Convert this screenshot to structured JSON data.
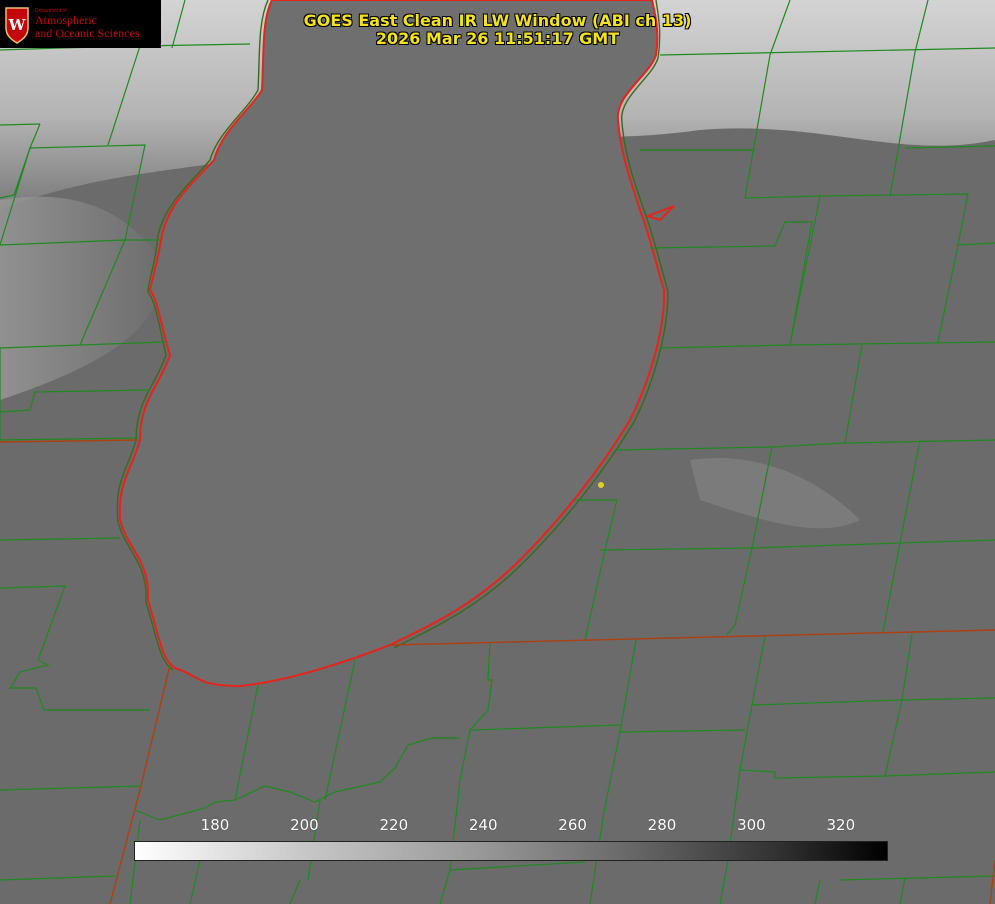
{
  "title": {
    "line1": "GOES East Clean IR LW Window (ABI ch 13)",
    "line2": "2026 Mar 26 11:51:17 GMT"
  },
  "logo": {
    "department": "Department of",
    "line1": "Atmospheric",
    "line2": "and Oceanic Sciences",
    "crest_letter": "W"
  },
  "colorbar": {
    "ticks": [
      "180",
      "200",
      "220",
      "240",
      "260",
      "280",
      "300",
      "320"
    ]
  },
  "colors": {
    "title": "#f4e21a",
    "lake_outline": "#e8231a",
    "county_lines": "#1f8a1f",
    "state_lines": "#b04010",
    "marker": "#e0d020",
    "logo_red": "#c5050c"
  },
  "map": {
    "feature": "lake-michigan-outline",
    "marker": "station-dot"
  }
}
